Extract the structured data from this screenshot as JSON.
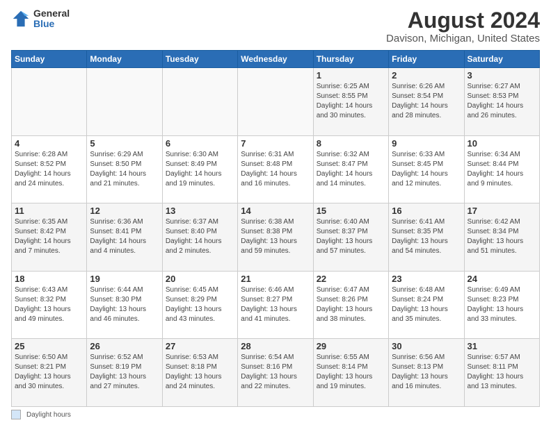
{
  "logo": {
    "general": "General",
    "blue": "Blue"
  },
  "title": "August 2024",
  "subtitle": "Davison, Michigan, United States",
  "days_of_week": [
    "Sunday",
    "Monday",
    "Tuesday",
    "Wednesday",
    "Thursday",
    "Friday",
    "Saturday"
  ],
  "footer_label": "Daylight hours",
  "weeks": [
    [
      {
        "day": "",
        "info": ""
      },
      {
        "day": "",
        "info": ""
      },
      {
        "day": "",
        "info": ""
      },
      {
        "day": "",
        "info": ""
      },
      {
        "day": "1",
        "info": "Sunrise: 6:25 AM\nSunset: 8:55 PM\nDaylight: 14 hours and 30 minutes."
      },
      {
        "day": "2",
        "info": "Sunrise: 6:26 AM\nSunset: 8:54 PM\nDaylight: 14 hours and 28 minutes."
      },
      {
        "day": "3",
        "info": "Sunrise: 6:27 AM\nSunset: 8:53 PM\nDaylight: 14 hours and 26 minutes."
      }
    ],
    [
      {
        "day": "4",
        "info": "Sunrise: 6:28 AM\nSunset: 8:52 PM\nDaylight: 14 hours and 24 minutes."
      },
      {
        "day": "5",
        "info": "Sunrise: 6:29 AM\nSunset: 8:50 PM\nDaylight: 14 hours and 21 minutes."
      },
      {
        "day": "6",
        "info": "Sunrise: 6:30 AM\nSunset: 8:49 PM\nDaylight: 14 hours and 19 minutes."
      },
      {
        "day": "7",
        "info": "Sunrise: 6:31 AM\nSunset: 8:48 PM\nDaylight: 14 hours and 16 minutes."
      },
      {
        "day": "8",
        "info": "Sunrise: 6:32 AM\nSunset: 8:47 PM\nDaylight: 14 hours and 14 minutes."
      },
      {
        "day": "9",
        "info": "Sunrise: 6:33 AM\nSunset: 8:45 PM\nDaylight: 14 hours and 12 minutes."
      },
      {
        "day": "10",
        "info": "Sunrise: 6:34 AM\nSunset: 8:44 PM\nDaylight: 14 hours and 9 minutes."
      }
    ],
    [
      {
        "day": "11",
        "info": "Sunrise: 6:35 AM\nSunset: 8:42 PM\nDaylight: 14 hours and 7 minutes."
      },
      {
        "day": "12",
        "info": "Sunrise: 6:36 AM\nSunset: 8:41 PM\nDaylight: 14 hours and 4 minutes."
      },
      {
        "day": "13",
        "info": "Sunrise: 6:37 AM\nSunset: 8:40 PM\nDaylight: 14 hours and 2 minutes."
      },
      {
        "day": "14",
        "info": "Sunrise: 6:38 AM\nSunset: 8:38 PM\nDaylight: 13 hours and 59 minutes."
      },
      {
        "day": "15",
        "info": "Sunrise: 6:40 AM\nSunset: 8:37 PM\nDaylight: 13 hours and 57 minutes."
      },
      {
        "day": "16",
        "info": "Sunrise: 6:41 AM\nSunset: 8:35 PM\nDaylight: 13 hours and 54 minutes."
      },
      {
        "day": "17",
        "info": "Sunrise: 6:42 AM\nSunset: 8:34 PM\nDaylight: 13 hours and 51 minutes."
      }
    ],
    [
      {
        "day": "18",
        "info": "Sunrise: 6:43 AM\nSunset: 8:32 PM\nDaylight: 13 hours and 49 minutes."
      },
      {
        "day": "19",
        "info": "Sunrise: 6:44 AM\nSunset: 8:30 PM\nDaylight: 13 hours and 46 minutes."
      },
      {
        "day": "20",
        "info": "Sunrise: 6:45 AM\nSunset: 8:29 PM\nDaylight: 13 hours and 43 minutes."
      },
      {
        "day": "21",
        "info": "Sunrise: 6:46 AM\nSunset: 8:27 PM\nDaylight: 13 hours and 41 minutes."
      },
      {
        "day": "22",
        "info": "Sunrise: 6:47 AM\nSunset: 8:26 PM\nDaylight: 13 hours and 38 minutes."
      },
      {
        "day": "23",
        "info": "Sunrise: 6:48 AM\nSunset: 8:24 PM\nDaylight: 13 hours and 35 minutes."
      },
      {
        "day": "24",
        "info": "Sunrise: 6:49 AM\nSunset: 8:23 PM\nDaylight: 13 hours and 33 minutes."
      }
    ],
    [
      {
        "day": "25",
        "info": "Sunrise: 6:50 AM\nSunset: 8:21 PM\nDaylight: 13 hours and 30 minutes."
      },
      {
        "day": "26",
        "info": "Sunrise: 6:52 AM\nSunset: 8:19 PM\nDaylight: 13 hours and 27 minutes."
      },
      {
        "day": "27",
        "info": "Sunrise: 6:53 AM\nSunset: 8:18 PM\nDaylight: 13 hours and 24 minutes."
      },
      {
        "day": "28",
        "info": "Sunrise: 6:54 AM\nSunset: 8:16 PM\nDaylight: 13 hours and 22 minutes."
      },
      {
        "day": "29",
        "info": "Sunrise: 6:55 AM\nSunset: 8:14 PM\nDaylight: 13 hours and 19 minutes."
      },
      {
        "day": "30",
        "info": "Sunrise: 6:56 AM\nSunset: 8:13 PM\nDaylight: 13 hours and 16 minutes."
      },
      {
        "day": "31",
        "info": "Sunrise: 6:57 AM\nSunset: 8:11 PM\nDaylight: 13 hours and 13 minutes."
      }
    ]
  ]
}
